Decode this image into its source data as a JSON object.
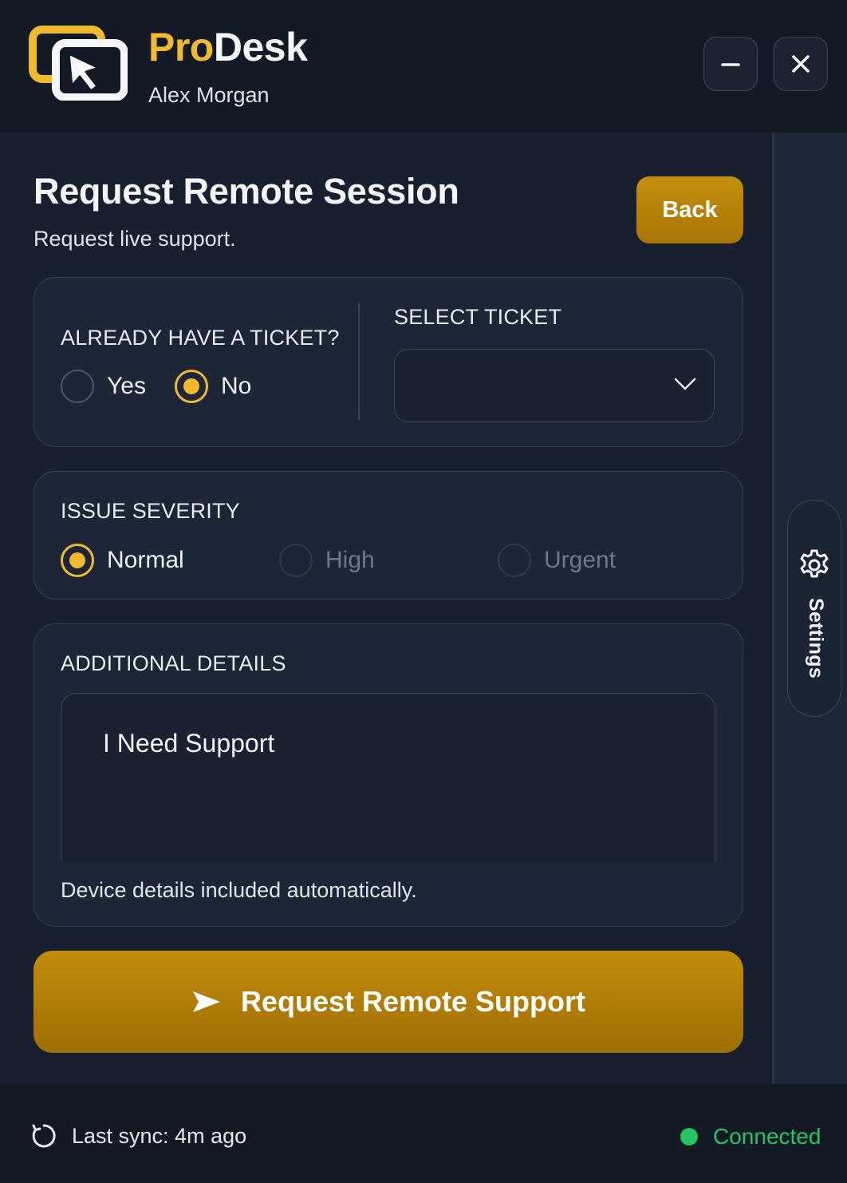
{
  "header": {
    "brand_pro": "Pro",
    "brand_desk": "Desk",
    "user_name": "Alex Morgan",
    "logo_icon": "cursor-window-logo-icon",
    "minimize_icon": "minus-icon",
    "close_icon": "close-icon"
  },
  "page": {
    "title": "Request Remote Session",
    "subtitle": "Request live support.",
    "back_label": "Back"
  },
  "ticket": {
    "question": "ALREADY HAVE A TICKET?",
    "options": [
      "Yes",
      "No"
    ],
    "selected": "No",
    "select_label": "SELECT TICKET",
    "select_value": ""
  },
  "severity": {
    "label": "ISSUE SEVERITY",
    "options": [
      "Normal",
      "High",
      "Urgent"
    ],
    "selected": "Normal"
  },
  "details": {
    "label": "ADDITIONAL DETAILS",
    "value": "I Need Support",
    "hint": "Device details included automatically."
  },
  "submit": {
    "label": "Request Remote Support",
    "icon": "send-icon"
  },
  "sidebar": {
    "settings_label": "Settings",
    "settings_icon": "gear-icon"
  },
  "footer": {
    "sync_text": "Last sync: 4m ago",
    "status_text": "Connected"
  },
  "colors": {
    "accent": "#f0b92e",
    "button_gold": "#b47f08",
    "status_green": "#22c55e",
    "background": "#161c27"
  }
}
